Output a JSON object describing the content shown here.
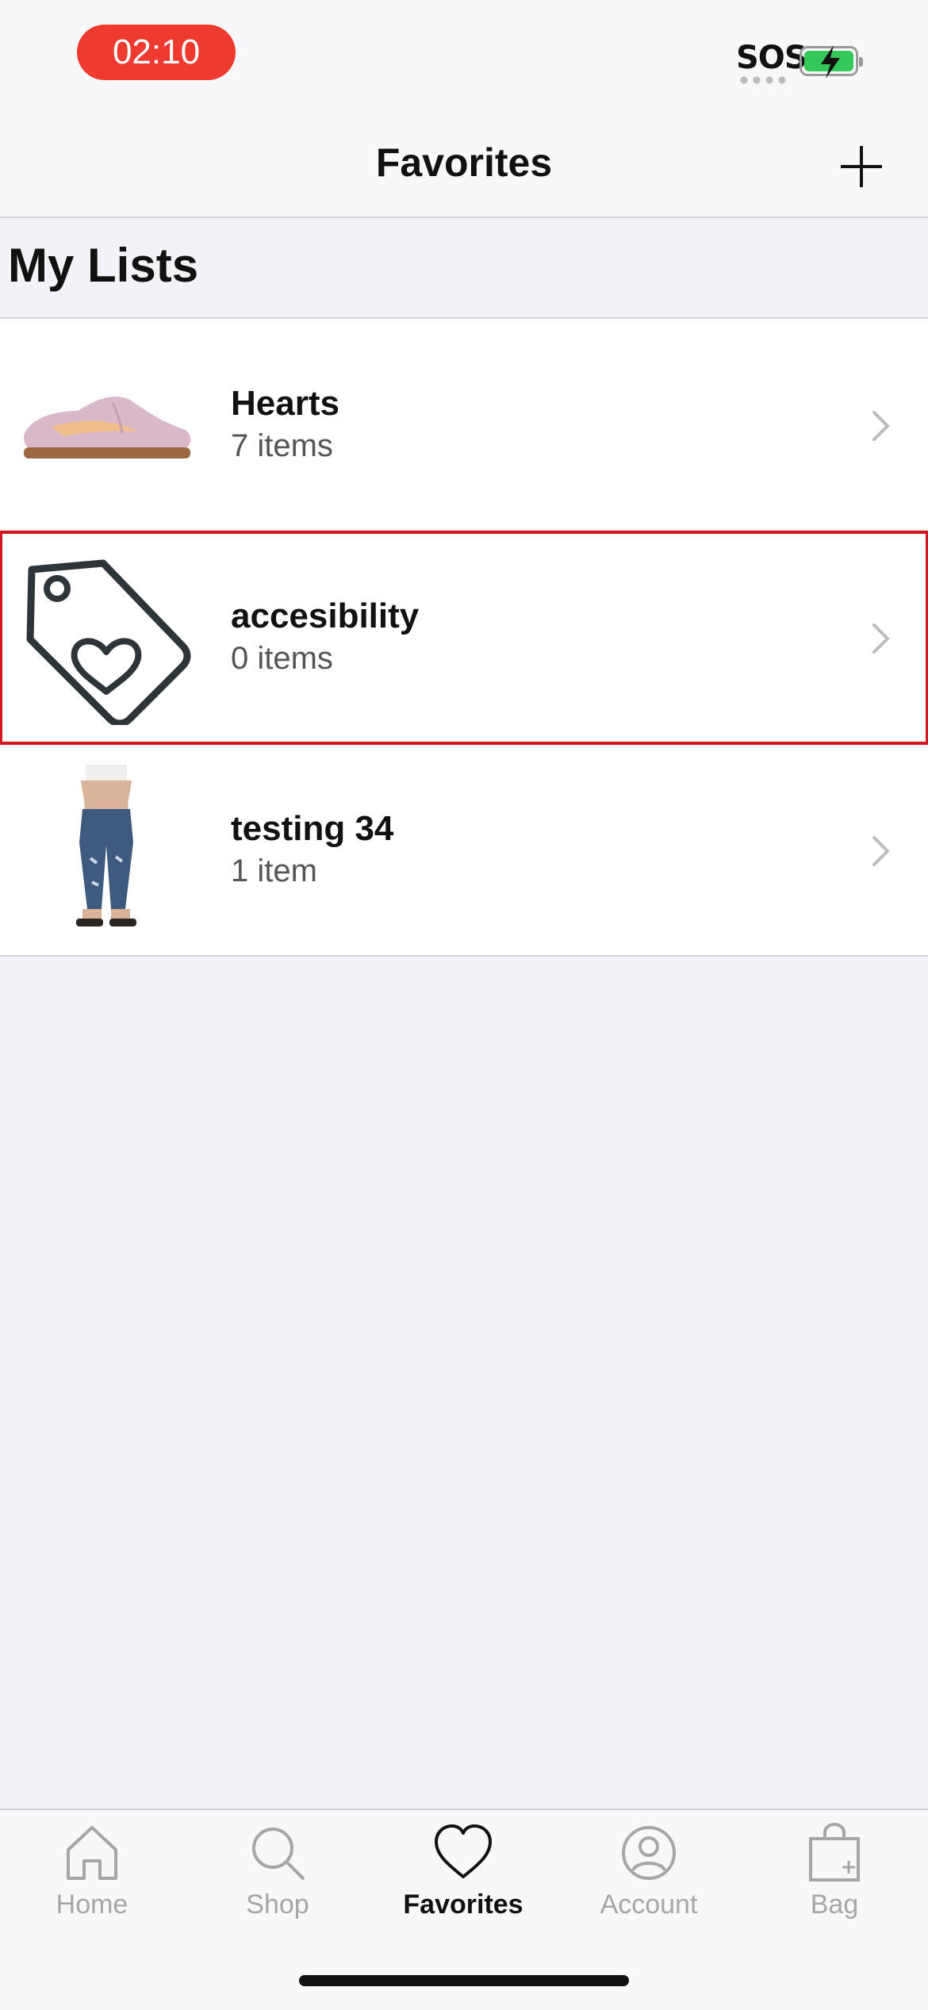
{
  "status_bar": {
    "time": "02:10",
    "sos": "SOS",
    "colors": {
      "time_pill": "#ef3b2f",
      "battery": "#34c759"
    }
  },
  "navbar": {
    "title": "Favorites",
    "add_icon": "plus-icon"
  },
  "section": {
    "title": "My Lists"
  },
  "lists": [
    {
      "name": "Hearts",
      "count": "7 items",
      "thumb": "pink-sneaker-image"
    },
    {
      "name": "accesibility",
      "count": "0 items",
      "thumb": "heart-tag-icon",
      "highlighted": true
    },
    {
      "name": "testing 34",
      "count": "1 item",
      "thumb": "jeans-model-image"
    }
  ],
  "tabbar": {
    "items": [
      {
        "label": "Home",
        "icon": "home-icon"
      },
      {
        "label": "Shop",
        "icon": "search-icon"
      },
      {
        "label": "Favorites",
        "icon": "heart-icon",
        "active": true
      },
      {
        "label": "Account",
        "icon": "account-icon"
      },
      {
        "label": "Bag",
        "icon": "bag-icon"
      }
    ]
  },
  "colors": {
    "highlight": "#d4171e",
    "background": "#f2f2f7"
  }
}
